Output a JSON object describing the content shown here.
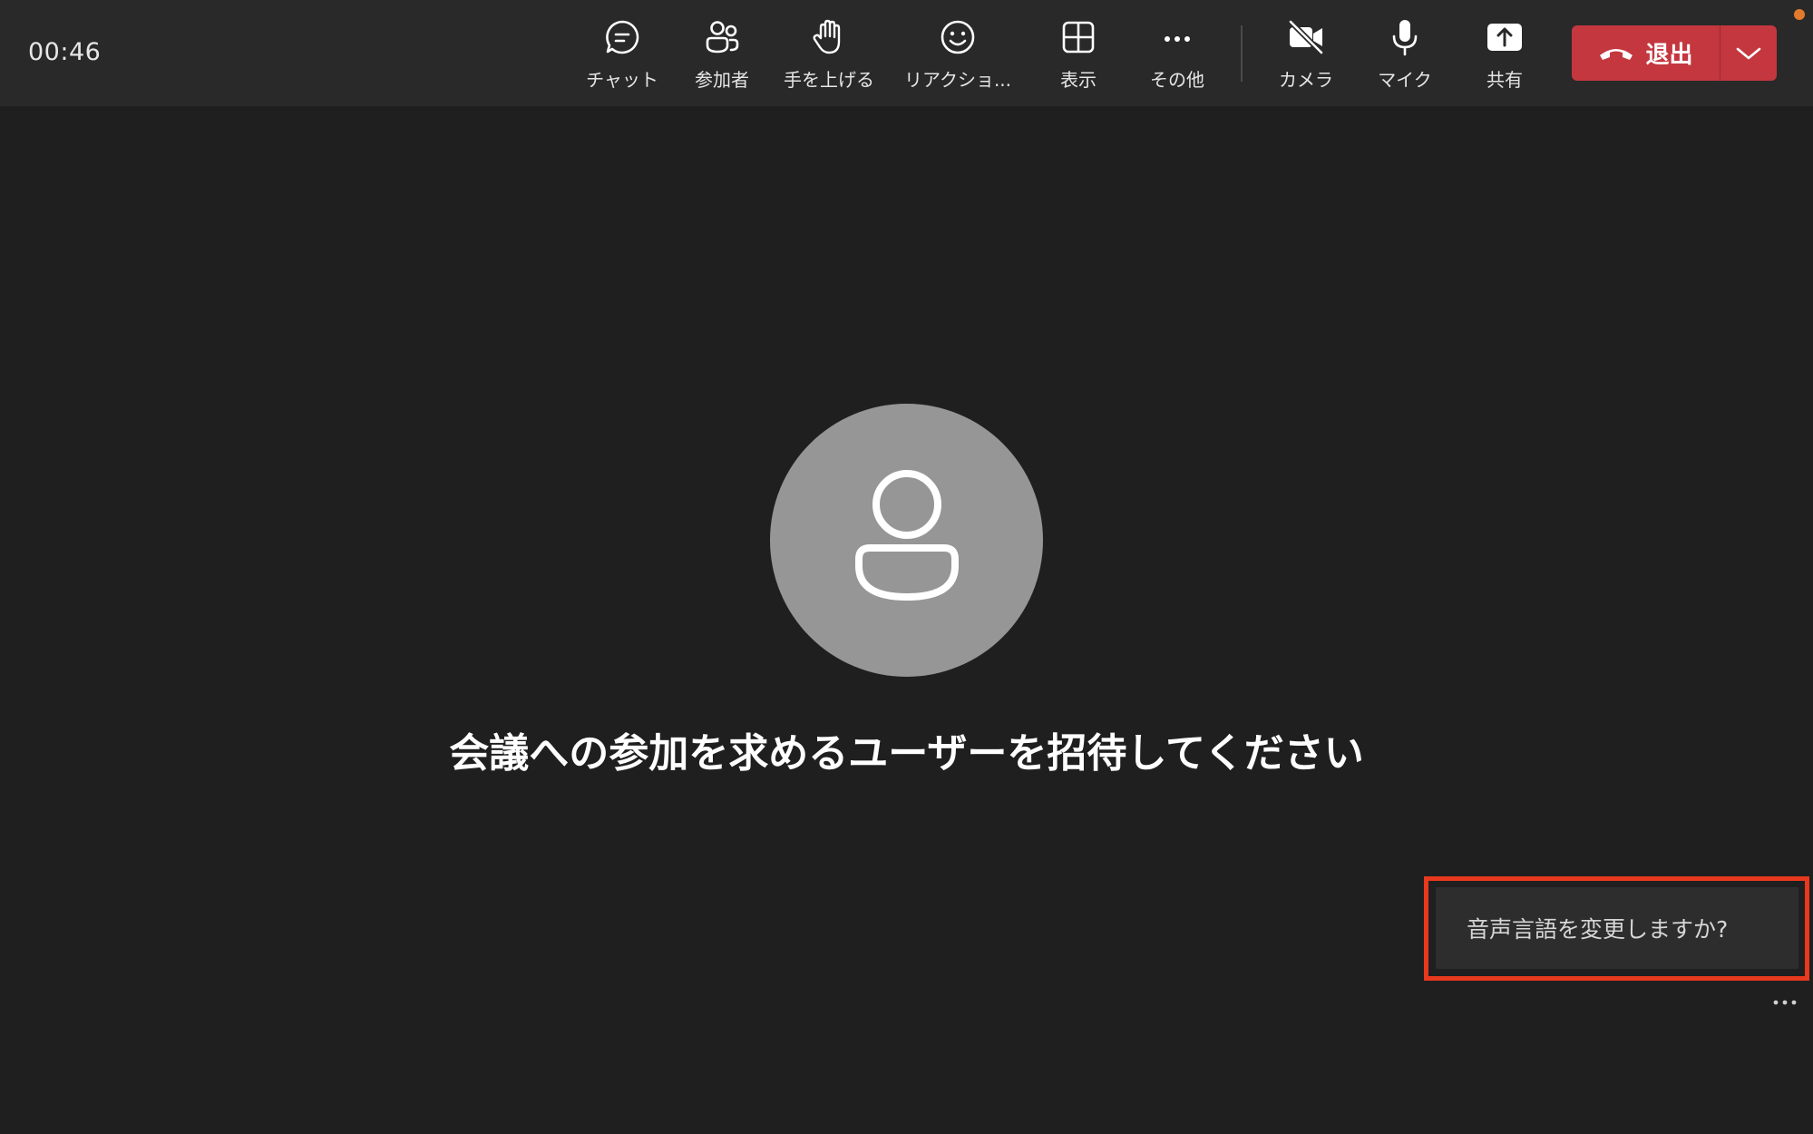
{
  "header": {
    "timer": "00:46",
    "tools": [
      {
        "id": "chat",
        "label": "チャット",
        "icon": "chat-icon"
      },
      {
        "id": "participants",
        "label": "参加者",
        "icon": "people-icon"
      },
      {
        "id": "raise-hand",
        "label": "手を上げる",
        "icon": "hand-icon"
      },
      {
        "id": "reactions",
        "label": "リアクショ...",
        "icon": "smiley-icon"
      },
      {
        "id": "view",
        "label": "表示",
        "icon": "grid-icon"
      },
      {
        "id": "more",
        "label": "その他",
        "icon": "more-icon"
      },
      {
        "id": "camera",
        "label": "カメラ",
        "icon": "camera-off-icon"
      },
      {
        "id": "mic",
        "label": "マイク",
        "icon": "microphone-icon"
      },
      {
        "id": "share",
        "label": "共有",
        "icon": "share-icon"
      }
    ],
    "leave": {
      "label": "退出",
      "icon": "hang-up-icon",
      "color": "#c4373f"
    }
  },
  "main": {
    "avatar_icon": "person-icon",
    "invite_message": "会議への参加を求めるユーザーを招待してください"
  },
  "popup": {
    "text": "音声言語を変更しますか?",
    "highlight_color": "#e8391f"
  },
  "colors": {
    "background": "#1f1f1f",
    "toolbar": "#292929",
    "avatar": "#969696"
  }
}
